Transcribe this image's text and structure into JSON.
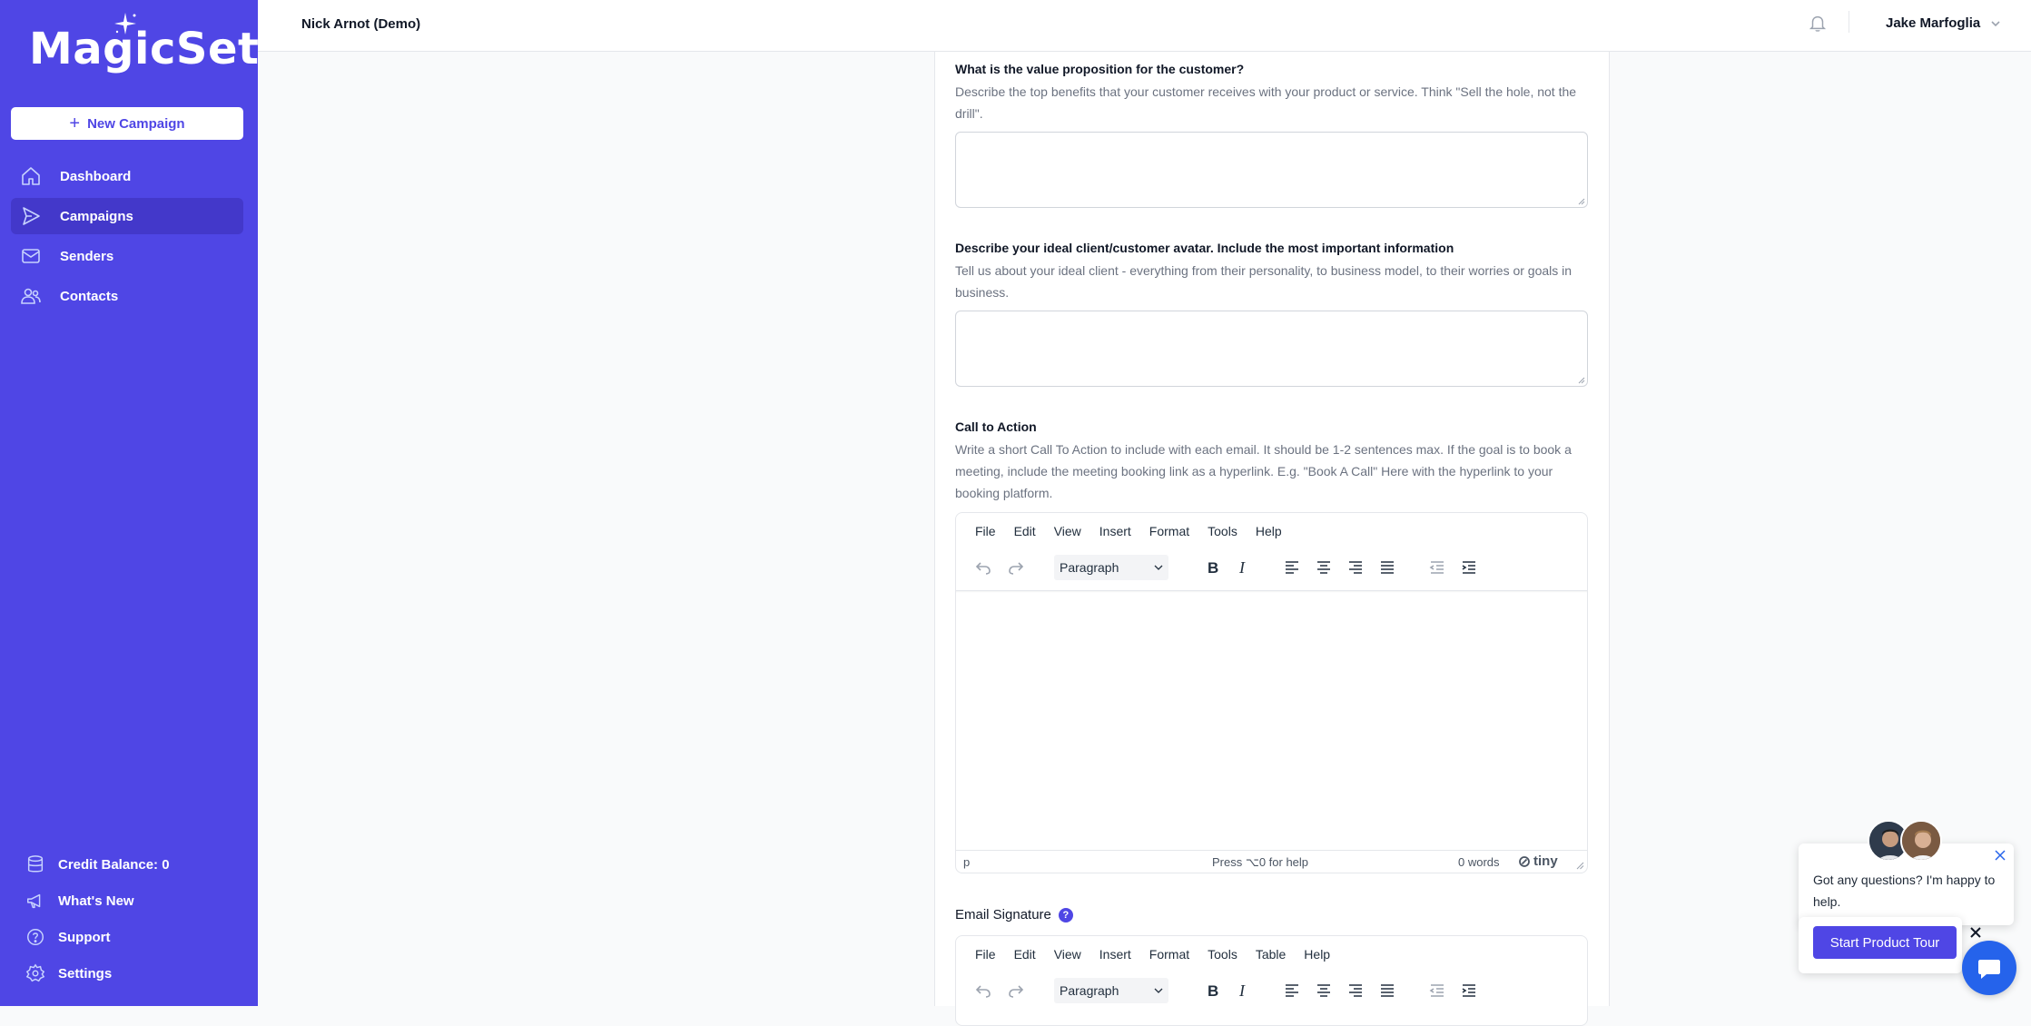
{
  "brand": {
    "name": "MagicSet"
  },
  "sidebar": {
    "new_campaign_label": "New Campaign",
    "nav": [
      {
        "label": "Dashboard",
        "icon": "home-icon"
      },
      {
        "label": "Campaigns",
        "icon": "send-icon",
        "active": true
      },
      {
        "label": "Senders",
        "icon": "mail-icon"
      },
      {
        "label": "Contacts",
        "icon": "users-icon"
      }
    ],
    "bottom": [
      {
        "label": "Credit Balance: 0",
        "icon": "database-icon"
      },
      {
        "label": "What's New",
        "icon": "megaphone-icon"
      },
      {
        "label": "Support",
        "icon": "question-circle-icon"
      },
      {
        "label": "Settings",
        "icon": "gear-icon"
      }
    ]
  },
  "topbar": {
    "account": "Nick Arnot (Demo)",
    "user": "Jake Marfoglia"
  },
  "form": {
    "value_prop": {
      "label": "What is the value proposition for the customer?",
      "help": "Describe the top benefits that your customer receives with your product or service. Think \"Sell the hole, not the drill\".",
      "value": ""
    },
    "avatar": {
      "label": "Describe your ideal client/customer avatar. Include the most important information",
      "help": "Tell us about your ideal client - everything from their personality, to business model, to their worries or goals in business.",
      "value": ""
    },
    "cta": {
      "label": "Call to Action",
      "help": "Write a short Call To Action to include with each email. It should be 1-2 sentences max. If the goal is to book a meeting, include the meeting booking link as a hyperlink. E.g. \"Book A Call\" Here with the hyperlink to your booking platform."
    },
    "signature": {
      "label": "Email Signature",
      "help_badge": "?"
    }
  },
  "editor_cta": {
    "menus": [
      "File",
      "Edit",
      "View",
      "Insert",
      "Format",
      "Tools",
      "Help"
    ],
    "block_format": "Paragraph",
    "status_path": "p",
    "status_help": "Press ⌥0 for help",
    "word_count": "0 words",
    "brand": "tiny"
  },
  "editor_sig": {
    "menus": [
      "File",
      "Edit",
      "View",
      "Insert",
      "Format",
      "Tools",
      "Table",
      "Help"
    ],
    "block_format": "Paragraph"
  },
  "chat": {
    "message": "Got any questions? I'm happy to help.",
    "tour_button": "Start Product Tour"
  },
  "colors": {
    "sidebar": "#4f46e5",
    "sidebar_active": "#4338ca",
    "accent": "#4f46e5",
    "chat": "#2563eb"
  }
}
